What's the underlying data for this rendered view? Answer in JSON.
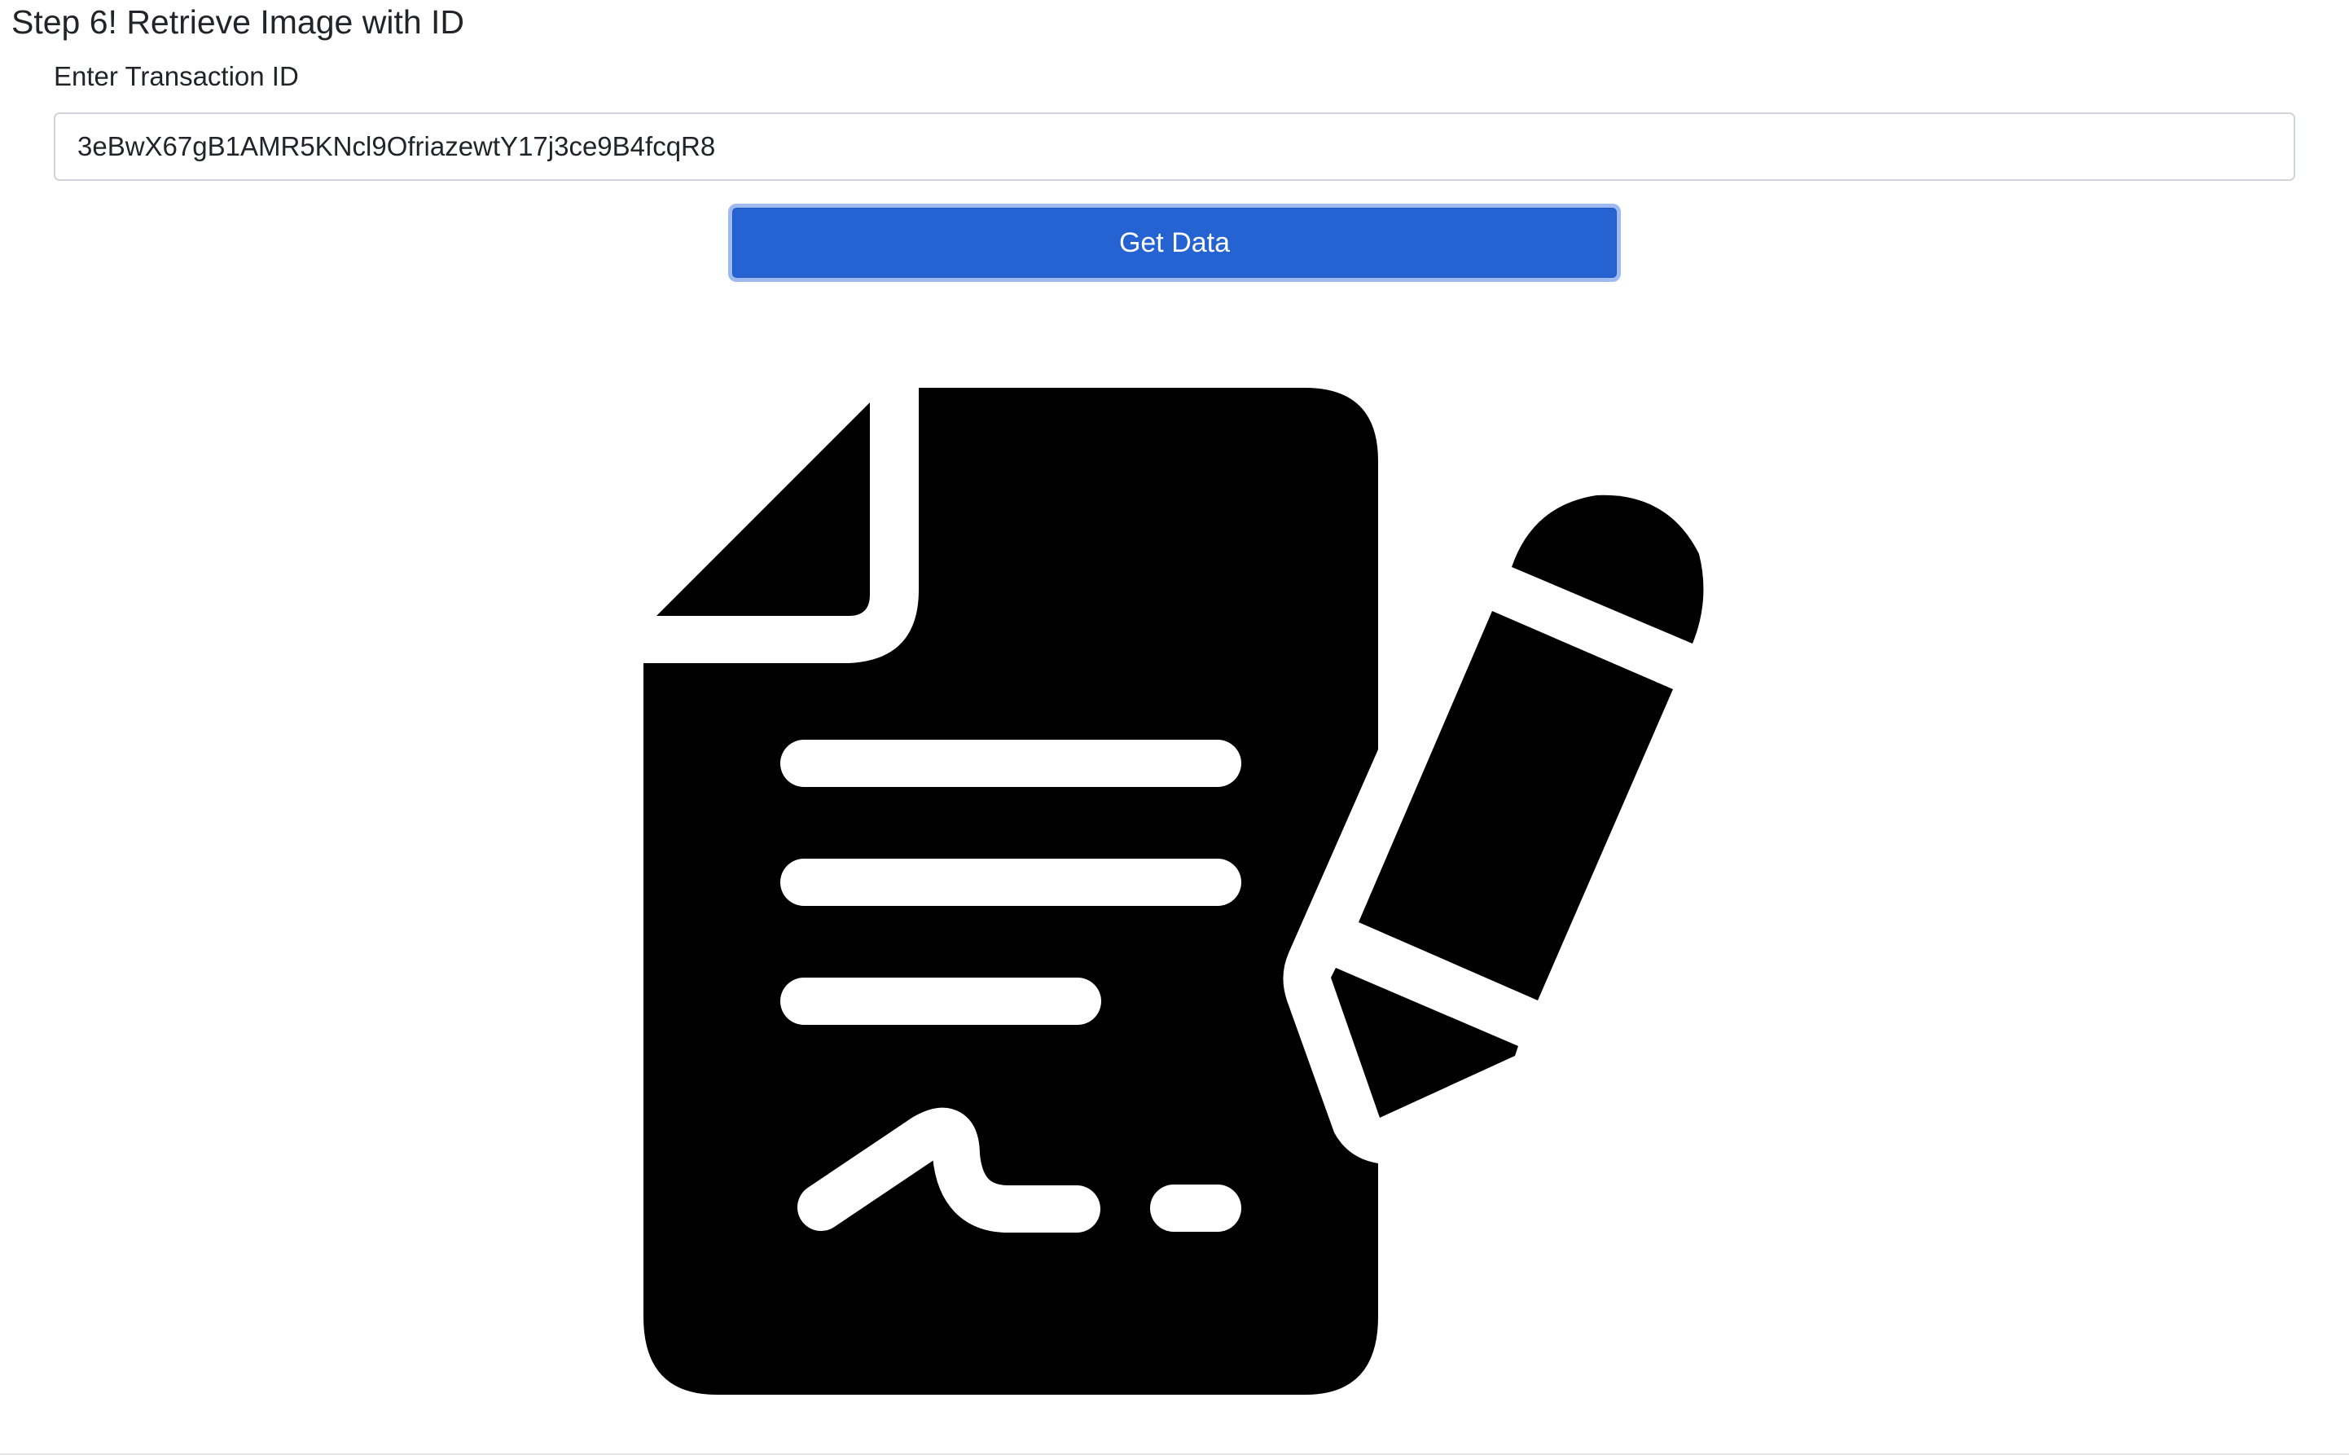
{
  "section": {
    "title": "Step 6! Retrieve Image with ID"
  },
  "form": {
    "id_label": "Enter Transaction ID",
    "id_value": "3eBwX67gB1AMR5KNcl9OfriazewtY17j3ce9B4fcqR8",
    "submit_label": "Get Data"
  },
  "result": {
    "image_icon": "signed-document-icon",
    "colors": {
      "icon": "#000000",
      "button": "#2563d2",
      "button_focus_ring": "#9ebaf0"
    }
  }
}
